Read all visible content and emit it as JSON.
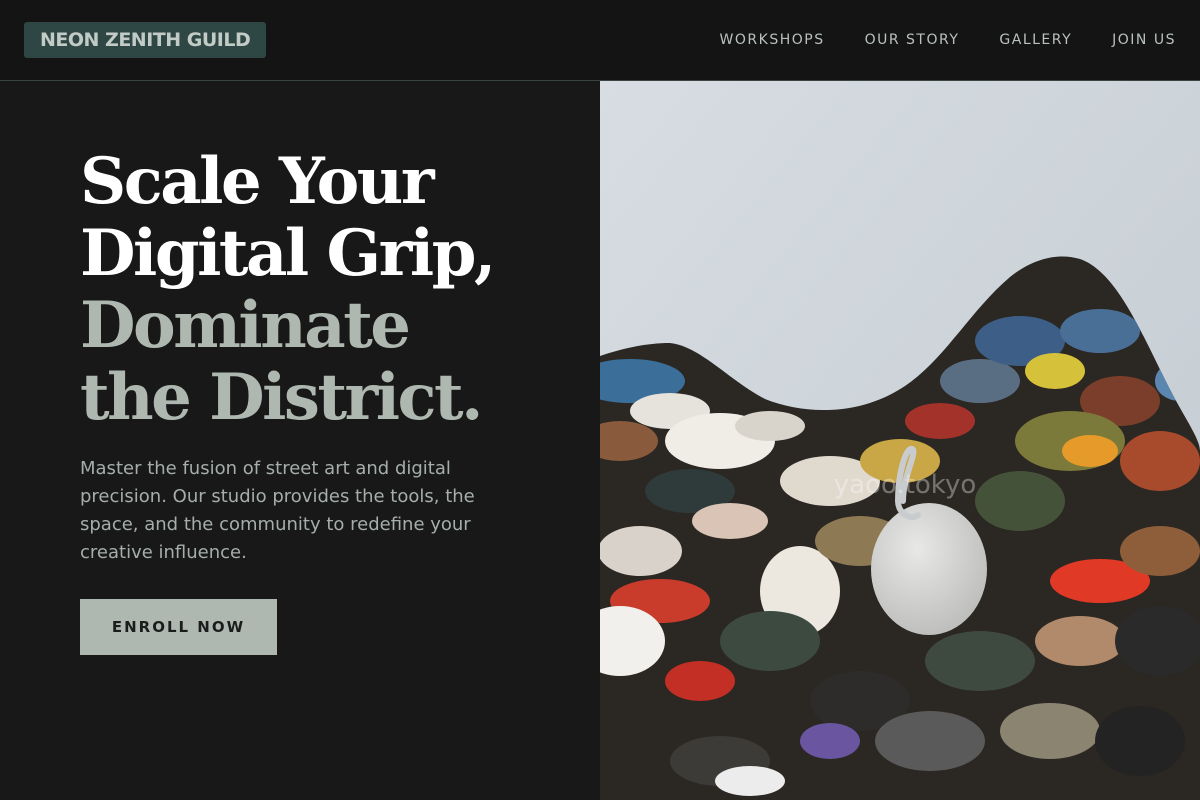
{
  "brand": {
    "name": "NEON ZENITH GUILD"
  },
  "nav": {
    "items": [
      {
        "label": "WORKSHOPS"
      },
      {
        "label": "OUR STORY"
      },
      {
        "label": "GALLERY"
      },
      {
        "label": "JOIN US"
      }
    ]
  },
  "hero": {
    "headline_line1": "Scale Your",
    "headline_line2": "Digital Grip,",
    "headline_line3": "Dominate",
    "headline_line4": "the District.",
    "description": "Master the fusion of street art and digital precision. Our studio provides the tools, the space, and the community to redefine your creative influence.",
    "cta_label": "ENROLL NOW",
    "image_watermark": "yaoo.tokyo"
  },
  "colors": {
    "background": "#181818",
    "topbar": "#141414",
    "logo_bg": "#2f4744",
    "accent_sage": "#aeb8b0",
    "nav_text": "#b9c1bd"
  }
}
